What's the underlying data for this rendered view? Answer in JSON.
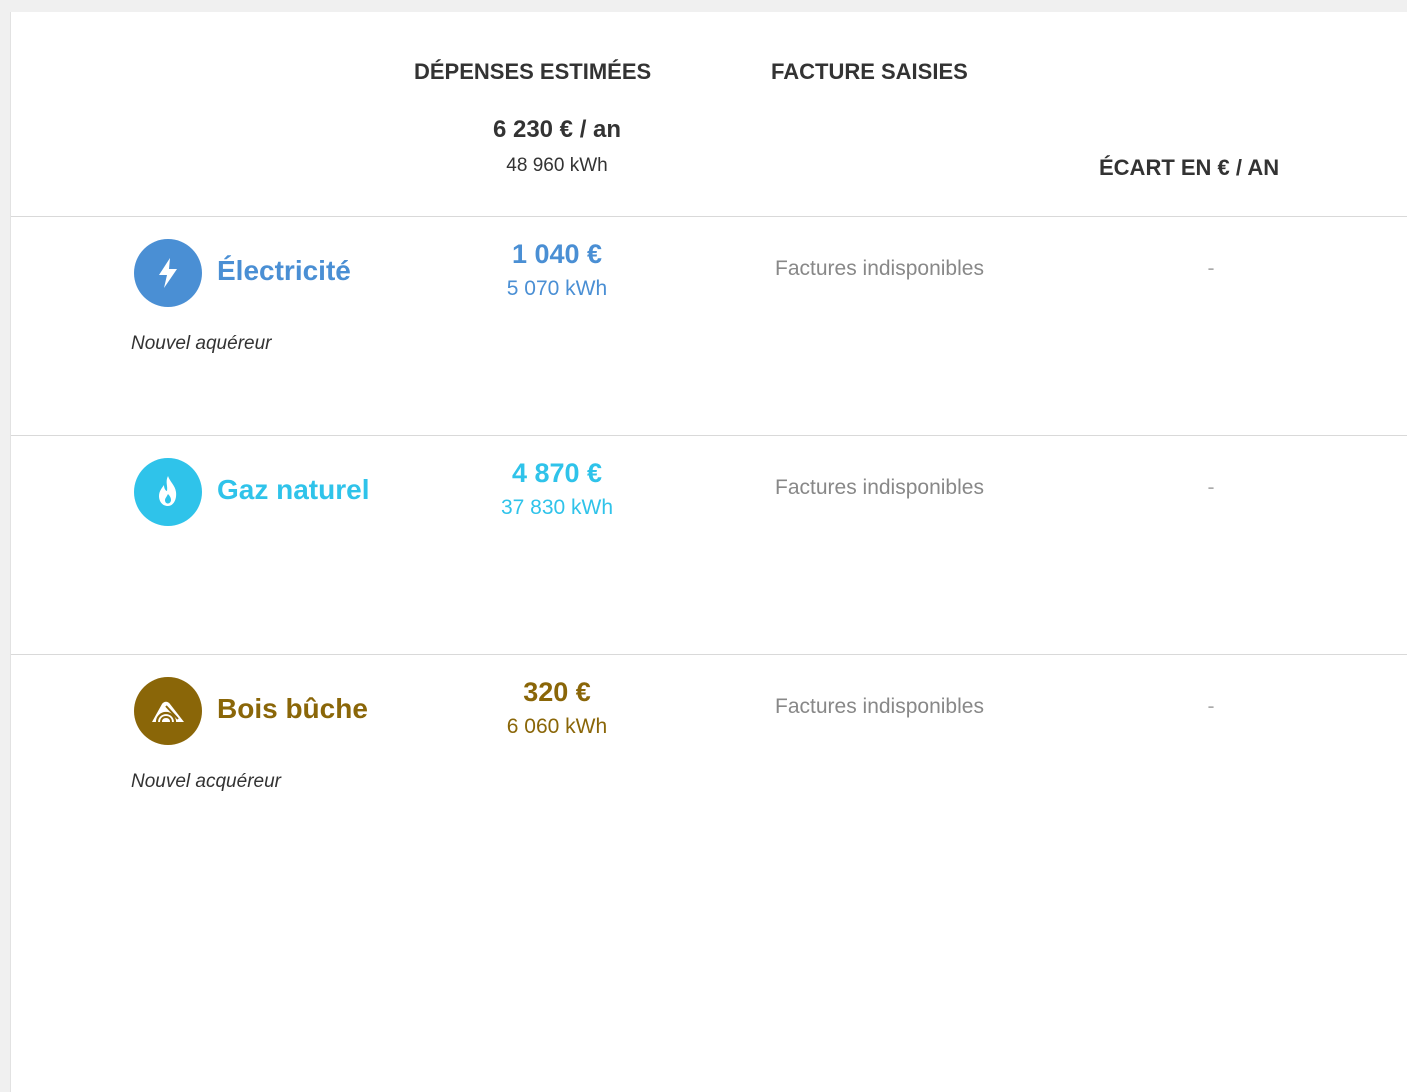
{
  "header": {
    "col_estimated": "DÉPENSES ESTIMÉES",
    "col_bills": "FACTURE SAISIES",
    "col_gap": "ÉCART EN € / AN",
    "total_amount": "6 230 € / an",
    "total_kwh": "48 960 kWh"
  },
  "rows": [
    {
      "name": "Électricité",
      "icon": "lightning-icon",
      "color": "#4a8fd4",
      "amount": "1 040 €",
      "kwh": "5 070 kWh",
      "bills": "Factures indisponibles",
      "gap": "-",
      "note": "Nouvel aquéreur"
    },
    {
      "name": "Gaz naturel",
      "icon": "flame-icon",
      "color": "#2fc3ea",
      "amount": "4 870 €",
      "kwh": "37 830 kWh",
      "bills": "Factures indisponibles",
      "gap": "-",
      "note": ""
    },
    {
      "name": "Bois bûche",
      "icon": "wood-logs-icon",
      "color": "#8a6608",
      "amount": "320 €",
      "kwh": "6 060 kWh",
      "bills": "Factures indisponibles",
      "gap": "-",
      "note": "Nouvel acquéreur"
    }
  ]
}
